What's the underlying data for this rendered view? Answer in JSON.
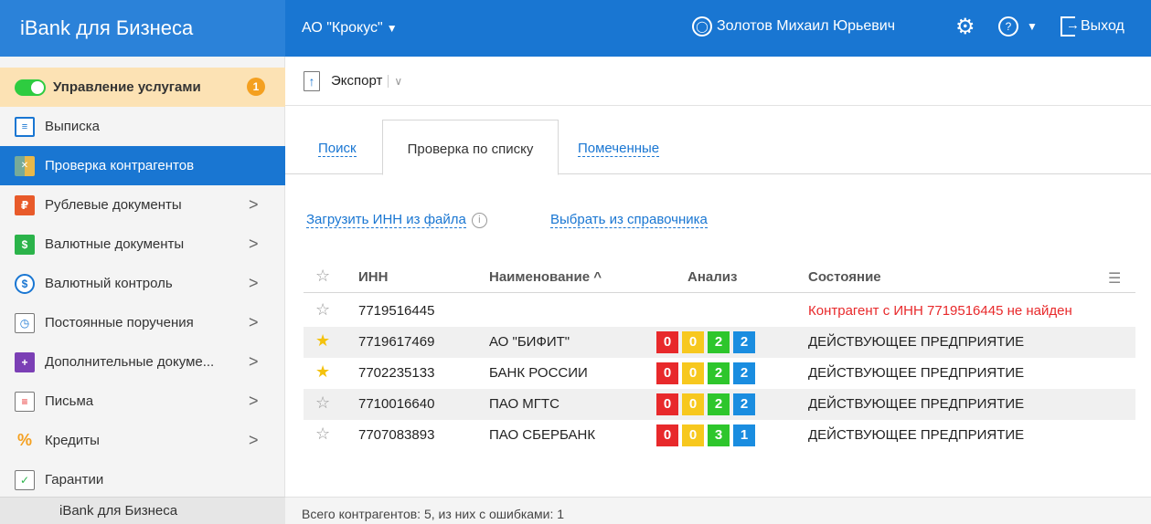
{
  "app": {
    "brand": "iBank для Бизнеса"
  },
  "header": {
    "org": "АО \"Крокус\"",
    "user": "Золотов Михаил Юрьевич",
    "logout": "Выход"
  },
  "sidebar": {
    "items": [
      {
        "label": "Управление услугами",
        "badge": "1"
      },
      {
        "label": "Выписка"
      },
      {
        "label": "Проверка контрагентов"
      },
      {
        "label": "Рублевые документы"
      },
      {
        "label": "Валютные документы"
      },
      {
        "label": "Валютный контроль"
      },
      {
        "label": "Постоянные поручения"
      },
      {
        "label": "Дополнительные докуме..."
      },
      {
        "label": "Письма"
      },
      {
        "label": "Кредиты"
      },
      {
        "label": "Гарантии"
      }
    ],
    "footer": "iBank для Бизнеса"
  },
  "toolbar": {
    "export": "Экспорт"
  },
  "tabs": [
    "Поиск",
    "Проверка по списку",
    "Помеченные"
  ],
  "actions": {
    "load": "Загрузить ИНН из файла",
    "choose": "Выбрать из справочника"
  },
  "table": {
    "headers": {
      "inn": "ИНН",
      "name": "Наименование ^",
      "analysis": "Анализ",
      "state": "Состояние"
    },
    "rows": [
      {
        "starred": false,
        "inn": "7719516445",
        "name": "",
        "pills": [],
        "state": "Контрагент с ИНН 7719516445 не найден"
      },
      {
        "starred": true,
        "inn": "7719617469",
        "name": "АО \"БИФИТ\"",
        "pills": [
          "0",
          "0",
          "2",
          "2"
        ],
        "state": "ДЕЙСТВУЮЩЕЕ ПРЕДПРИЯТИЕ"
      },
      {
        "starred": true,
        "inn": "7702235133",
        "name": "БАНК РОССИИ",
        "pills": [
          "0",
          "0",
          "2",
          "2"
        ],
        "state": "ДЕЙСТВУЮЩЕЕ ПРЕДПРИЯТИЕ"
      },
      {
        "starred": false,
        "inn": "7710016640",
        "name": "ПАО МГТС",
        "pills": [
          "0",
          "0",
          "2",
          "2"
        ],
        "state": "ДЕЙСТВУЮЩЕЕ ПРЕДПРИЯТИЕ"
      },
      {
        "starred": false,
        "inn": "7707083893",
        "name": "ПАО СБЕРБАНК",
        "pills": [
          "0",
          "0",
          "3",
          "1"
        ],
        "state": "ДЕЙСТВУЮЩЕЕ ПРЕДПРИЯТИЕ"
      }
    ]
  },
  "footer": {
    "summary": "Всего контрагентов: 5, из них с ошибками: 1"
  },
  "colors": {
    "accent": "#1976d2",
    "error": "#e8292b",
    "star": "#f4c20d"
  }
}
